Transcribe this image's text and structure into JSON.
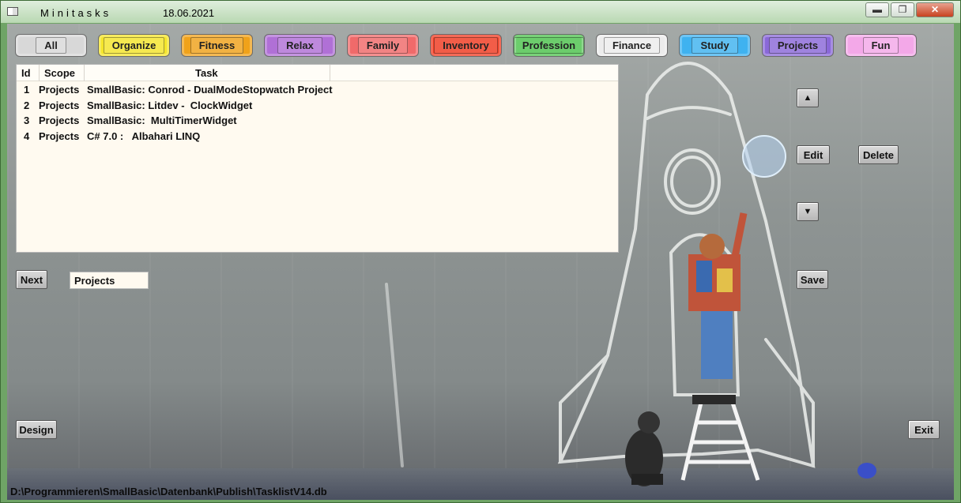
{
  "window": {
    "title": "Minitasks",
    "date": "18.06.2021",
    "controls": {
      "minimize": "▬",
      "maximize": "❐",
      "close": "✕"
    }
  },
  "categories": [
    {
      "label": "All",
      "color": "#d8d8d8"
    },
    {
      "label": "Organize",
      "color": "#f5e52a"
    },
    {
      "label": "Fitness",
      "color": "#f0a21a"
    },
    {
      "label": "Relax",
      "color": "#b070d6"
    },
    {
      "label": "Family",
      "color": "#f06a6a"
    },
    {
      "label": "Inventory",
      "color": "#f03a20"
    },
    {
      "label": "Profession",
      "color": "#4cc24c"
    },
    {
      "label": "Finance",
      "color": "#ececec"
    },
    {
      "label": "Study",
      "color": "#3fb2f0"
    },
    {
      "label": "Projects",
      "color": "#8a68d8"
    },
    {
      "label": "Fun",
      "color": "#f3a8e8"
    }
  ],
  "list": {
    "columns": [
      "Id",
      "Scope",
      "Task"
    ],
    "rows": [
      {
        "id": "1",
        "scope": "Projects",
        "task": "SmallBasic: Conrod - DualModeStopwatch Project"
      },
      {
        "id": "2",
        "scope": "Projects",
        "task": "SmallBasic: Litdev -  ClockWidget"
      },
      {
        "id": "3",
        "scope": "Projects",
        "task": "SmallBasic:  MultiTimerWidget"
      },
      {
        "id": "4",
        "scope": "Projects",
        "task": "C# 7.0 :   Albahari LINQ"
      }
    ]
  },
  "buttons": {
    "up": "▲",
    "edit": "Edit",
    "delete": "Delete",
    "down": "▼",
    "next": "Next",
    "save": "Save",
    "design": "Design",
    "exit": "Exit"
  },
  "scope_field": {
    "value": "Projects"
  },
  "status": {
    "path": "D:\\Programmieren\\SmallBasic\\Datenbank\\Publish\\TasklistV14.db"
  }
}
